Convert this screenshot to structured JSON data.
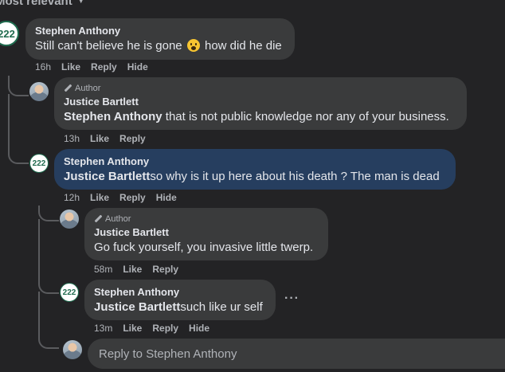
{
  "sort": {
    "label": "Most relevant"
  },
  "comments": [
    {
      "author": "Stephen Anthony",
      "avatar_text": "222",
      "text": "Still can't believe he is gone",
      "text_after_emoji": "how did he die",
      "time": "16h",
      "like": "Like",
      "reply": "Reply",
      "hide": "Hide"
    },
    {
      "badge": "Author",
      "author": "Justice Bartlett",
      "mention": "Stephen Anthony",
      "text": " that is not public knowledge nor any of your business.",
      "time": "13h",
      "like": "Like",
      "reply": "Reply"
    },
    {
      "author": "Stephen Anthony",
      "avatar_text": "222",
      "mention": "Justice Bartlett",
      "text": "so why is it up here about his death ? The man is dead",
      "time": "12h",
      "like": "Like",
      "reply": "Reply",
      "hide": "Hide"
    },
    {
      "badge": "Author",
      "author": "Justice Bartlett",
      "text": "Go fuck yourself, you invasive little twerp.",
      "time": "58m",
      "like": "Like",
      "reply": "Reply"
    },
    {
      "author": "Stephen Anthony",
      "avatar_text": "222",
      "mention": "Justice Bartlett",
      "text": "such like ur self",
      "more": "···",
      "time": "13m",
      "like": "Like",
      "reply": "Reply",
      "hide": "Hide"
    }
  ],
  "reply_box": {
    "placeholder": "Reply to Stephen Anthony"
  },
  "colors": {
    "background": "#232325",
    "bubble": "#3a3b3c",
    "highlight_bubble": "#263e5f",
    "avatar_ring": "#1f6b4e"
  }
}
